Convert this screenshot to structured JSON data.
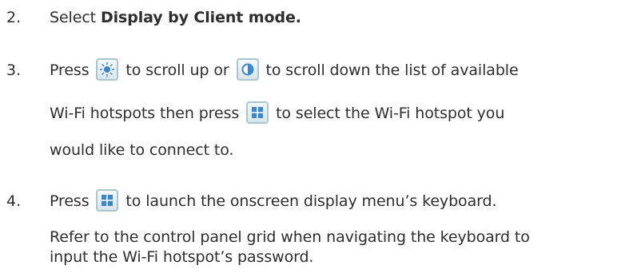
{
  "steps": [
    {
      "number": "2.",
      "text_before": "Select ",
      "bold": "Display by Client mode."
    },
    {
      "number": "3.",
      "line1_a": "Press",
      "line1_b": "to scroll up or",
      "line1_c": "to scroll down the list of available",
      "line2_a": "Wi-Fi hotspots then press",
      "line2_b": "to select the Wi-Fi hotspot you",
      "line3": "would like to connect to."
    },
    {
      "number": "4.",
      "line1_a": "Press",
      "line1_b": "to launch the onscreen display menu’s keyboard.",
      "line2": "Refer to the control panel grid when navigating the keyboard to",
      "line3": "input the Wi-Fi hotspot’s password."
    }
  ],
  "icons": {
    "brightness": "brightness-icon",
    "contrast": "contrast-icon",
    "menu": "menu-icon"
  },
  "colors": {
    "text": "#2e2e2e",
    "button_border": "#a9c6cf",
    "icon_blue": "#3b88c8"
  }
}
